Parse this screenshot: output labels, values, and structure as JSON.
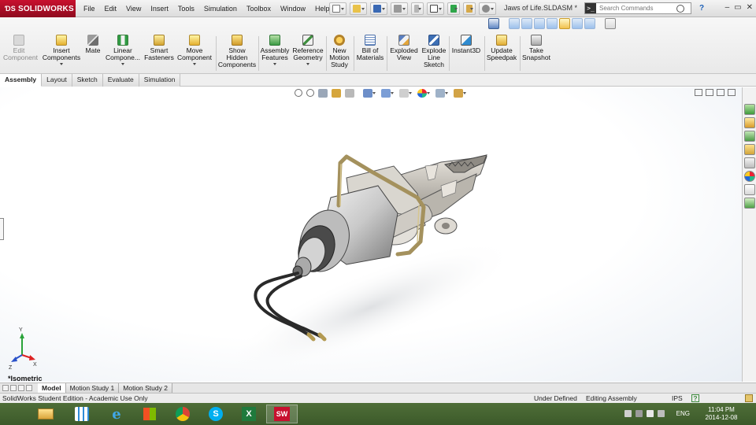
{
  "app": {
    "brand": "SOLIDWORKS",
    "document_title": "Jaws of Life.SLDASM *"
  },
  "menu": [
    "File",
    "Edit",
    "View",
    "Insert",
    "Tools",
    "Simulation",
    "Toolbox",
    "Window",
    "Help"
  ],
  "search": {
    "placeholder": "Search Commands"
  },
  "commands": [
    {
      "label": "Edit Component",
      "icon": "edit-component-icon",
      "disabled": true
    },
    {
      "label": "Insert Components",
      "icon": "insert-components-icon"
    },
    {
      "label": "Mate",
      "icon": "mate-icon"
    },
    {
      "label": "Linear Compone...",
      "icon": "linear-pattern-icon"
    },
    {
      "label": "Smart Fasteners",
      "icon": "smart-fasteners-icon"
    },
    {
      "label": "Move Component",
      "icon": "move-component-icon"
    },
    {
      "label": "Show Hidden Components",
      "icon": "show-hidden-icon"
    },
    {
      "label": "Assembly Features",
      "icon": "assembly-features-icon"
    },
    {
      "label": "Reference Geometry",
      "icon": "reference-geometry-icon"
    },
    {
      "label": "New Motion Study",
      "icon": "motion-study-icon"
    },
    {
      "label": "Bill of Materials",
      "icon": "bom-icon"
    },
    {
      "label": "Exploded View",
      "icon": "exploded-view-icon"
    },
    {
      "label": "Explode Line Sketch",
      "icon": "explode-line-icon"
    },
    {
      "label": "Instant3D",
      "icon": "instant3d-icon"
    },
    {
      "label": "Update Speedpak",
      "icon": "speedpak-icon"
    },
    {
      "label": "Take Snapshot",
      "icon": "snapshot-icon"
    }
  ],
  "tabs": [
    "Assembly",
    "Layout",
    "Sketch",
    "Evaluate",
    "Simulation"
  ],
  "active_tab": "Assembly",
  "viewport": {
    "view_name": "*Isometric",
    "triad": {
      "x": "X",
      "y": "Y",
      "z": "Z"
    }
  },
  "bottom_tabs": [
    "Model",
    "Motion Study 1",
    "Motion Study 2"
  ],
  "status": {
    "edition": "SolidWorks Student Edition - Academic Use Only",
    "definition": "Under Defined",
    "mode": "Editing Assembly",
    "units": "IPS",
    "help": "?"
  },
  "taskbar": {
    "apps": [
      "file-explorer-icon",
      "apps-grid-icon",
      "internet-explorer-icon",
      "chrome-icon",
      "skype-icon",
      "excel-icon",
      "solidworks-icon"
    ],
    "language": "ENG",
    "time": "11:04 PM",
    "date": "2014-12-08"
  },
  "colors": {
    "brand_red": "#c8102e",
    "taskbar_green": "#47652f",
    "active_view": "#f1c24e"
  }
}
